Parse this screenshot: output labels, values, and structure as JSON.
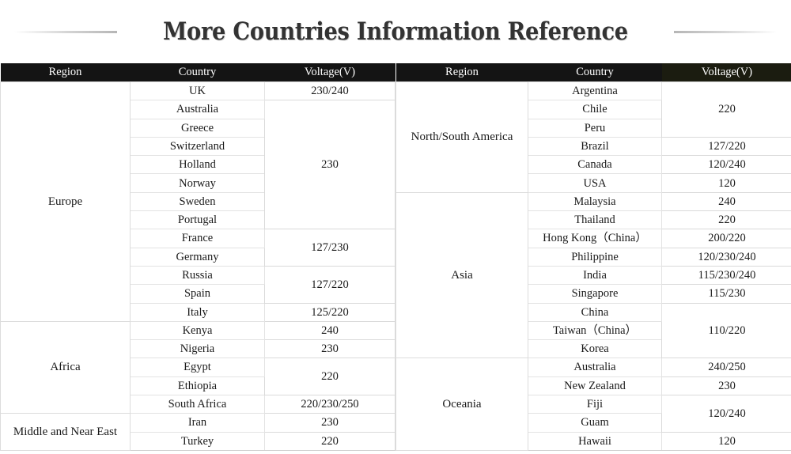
{
  "title": "More Countries Information Reference",
  "colors": {
    "header_background": "#141414",
    "header_highlight_background": "#1b1c10",
    "title_color": "#333333",
    "region_shade_light": "#f5f5f5",
    "region_shade_medium": "#ebebeb",
    "region_shade_dark": "#d8d8d8"
  },
  "left_table": {
    "headers": {
      "region": "Region",
      "country": "Country",
      "voltage": "Voltage(V)"
    },
    "regions": [
      {
        "name": "Europe",
        "shade": "shade-1",
        "countries": [
          "UK",
          "Australia",
          "Greece",
          "Switzerland",
          "Holland",
          "Norway",
          "Sweden",
          "Portugal",
          "France",
          "Germany",
          "Russia",
          "Spain",
          "Italy"
        ],
        "voltages": [
          {
            "value": "230/240",
            "span": 1
          },
          {
            "value": "230",
            "span": 7
          },
          {
            "value": "127/230",
            "span": 2
          },
          {
            "value": "127/220",
            "span": 2
          },
          {
            "value": "125/220",
            "span": 1
          }
        ]
      },
      {
        "name": "Africa",
        "shade": "shade-2",
        "countries": [
          "Kenya",
          "Nigeria",
          "Egypt",
          "Ethiopia",
          "South Africa"
        ],
        "voltages": [
          {
            "value": "240",
            "span": 1
          },
          {
            "value": "230",
            "span": 1
          },
          {
            "value": "220",
            "span": 2
          },
          {
            "value": "220/230/250",
            "span": 1
          }
        ]
      },
      {
        "name": "Middle and Near East",
        "shade": "shade-3",
        "countries": [
          "Iran",
          "Turkey"
        ],
        "voltages": [
          {
            "value": "230",
            "span": 1
          },
          {
            "value": "220",
            "span": 1
          }
        ]
      }
    ]
  },
  "right_table": {
    "headers": {
      "region": "Region",
      "country": "Country",
      "voltage": "Voltage(V)"
    },
    "regions": [
      {
        "name": "North/South America",
        "shade": "shade-3",
        "countries": [
          "Argentina",
          "Chile",
          "Peru",
          "Brazil",
          "Canada",
          "USA"
        ],
        "voltages": [
          {
            "value": "220",
            "span": 3
          },
          {
            "value": "127/220",
            "span": 1
          },
          {
            "value": "120/240",
            "span": 1
          },
          {
            "value": "120",
            "span": 1
          }
        ]
      },
      {
        "name": "Asia",
        "shade": "shade-2",
        "countries": [
          "Malaysia",
          "Thailand",
          "Hong Kong（China）",
          "Philippine",
          "India",
          "Singapore",
          "China",
          "Taiwan（China）",
          "Korea"
        ],
        "voltages": [
          {
            "value": "240",
            "span": 1
          },
          {
            "value": "220",
            "span": 1
          },
          {
            "value": "200/220",
            "span": 1
          },
          {
            "value": "120/230/240",
            "span": 1
          },
          {
            "value": "115/230/240",
            "span": 1
          },
          {
            "value": "115/230",
            "span": 1
          },
          {
            "value": "110/220",
            "span": 3
          }
        ]
      },
      {
        "name": "Oceania",
        "shade": "shade-1",
        "countries": [
          "Australia",
          "New Zealand",
          "Fiji",
          "Guam",
          "Hawaii"
        ],
        "voltages": [
          {
            "value": "240/250",
            "span": 1
          },
          {
            "value": "230",
            "span": 1
          },
          {
            "value": "120/240",
            "span": 2
          },
          {
            "value": "120",
            "span": 1
          }
        ]
      }
    ]
  }
}
